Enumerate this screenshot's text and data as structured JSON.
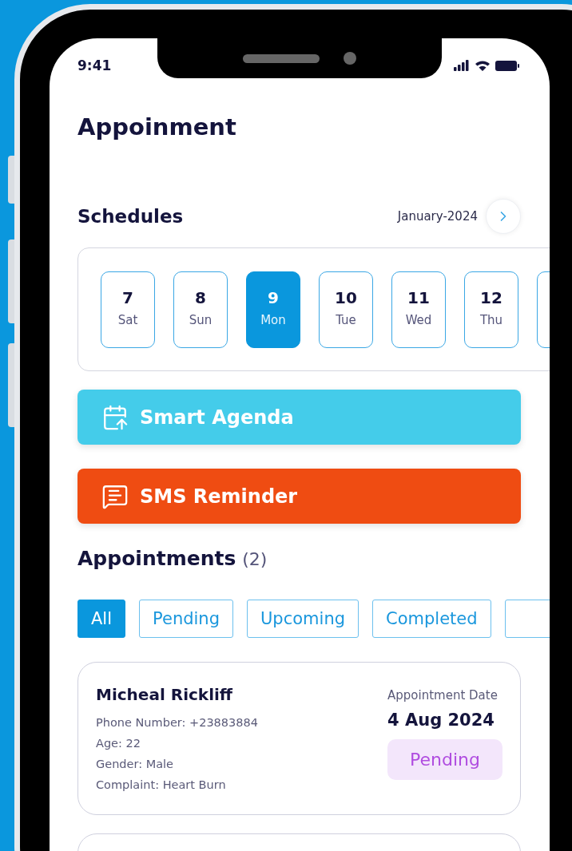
{
  "status_bar": {
    "time": "9:41"
  },
  "title": "Appoinment",
  "schedules": {
    "title": "Schedules",
    "month": "January-2024"
  },
  "days": [
    {
      "day": "7",
      "weekday": "Sat",
      "selected": false
    },
    {
      "day": "8",
      "weekday": "Sun",
      "selected": false
    },
    {
      "day": "9",
      "weekday": "Mon",
      "selected": true
    },
    {
      "day": "10",
      "weekday": "Tue",
      "selected": false
    },
    {
      "day": "11",
      "weekday": "Wed",
      "selected": false
    },
    {
      "day": "12",
      "weekday": "Thu",
      "selected": false
    }
  ],
  "actions": [
    {
      "label": "Smart Agenda",
      "kind": "agenda"
    },
    {
      "label": "SMS Reminder",
      "kind": "sms"
    }
  ],
  "appointments": {
    "title": "Appointments",
    "count": "(2)"
  },
  "filters": [
    {
      "label": "All",
      "selected": true
    },
    {
      "label": "Pending",
      "selected": false
    },
    {
      "label": "Upcoming",
      "selected": false
    },
    {
      "label": "Completed",
      "selected": false
    }
  ],
  "cards": [
    {
      "name": "Micheal Rickliff",
      "details": [
        "Phone Number: +23883884",
        "Age: 22",
        "Gender: Male",
        "Complaint: Heart Burn"
      ],
      "date_label": "Appointment Date",
      "date": "4 Aug 2024",
      "status": {
        "label": "Pending",
        "kind": "pending"
      }
    }
  ]
}
